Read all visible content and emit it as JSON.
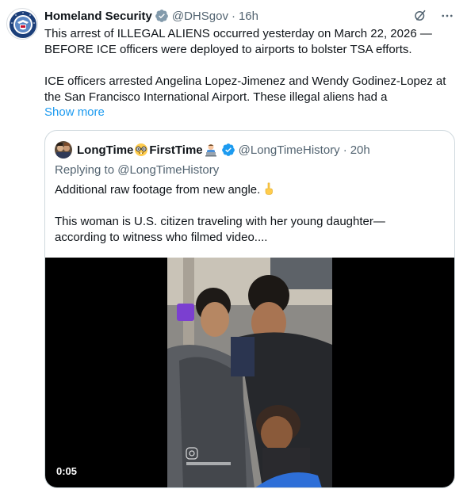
{
  "tweet": {
    "author_name": "Homeland Security",
    "handle": "@DHSgov",
    "separator": "·",
    "time": "16h",
    "text_line1": "This arrest of ILLEGAL ALIENS occurred yesterday on March 22, 2026 —",
    "text_line2": "BEFORE ICE officers were deployed to airports to bolster TSA efforts.",
    "text_line3": "ICE officers arrested Angelina Lopez-Jimenez and Wendy Godinez-Lopez at",
    "text_line4": "the San Francisco International Airport. These illegal aliens had a",
    "show_more": "Show more"
  },
  "quote": {
    "name_part1": "LongTime",
    "name_part2": "FirstTime",
    "handle": "@LongTimeHistory",
    "separator": "·",
    "time": "20h",
    "replying_prefix": "Replying to",
    "replying_handle": "@LongTimeHistory",
    "text_line1": "Additional raw footage from new angle.",
    "text_line2": "This woman is U.S. citizen traveling with her young daughter—",
    "text_line3": "according to witness who filmed video....",
    "video_duration": "0:05",
    "video_watermark": "ⓘ"
  },
  "colors": {
    "text": "#0f1419",
    "secondary": "#536471",
    "link": "#1d9bf0",
    "verified_blue": "#1d9bf0",
    "border": "#cfd9de"
  },
  "icons": [
    "dhs-seal-avatar",
    "verified-badge-icon",
    "grok-icon",
    "more-icon",
    "nerd-face-emoji",
    "technologist-emoji",
    "pointing-down-emoji"
  ]
}
